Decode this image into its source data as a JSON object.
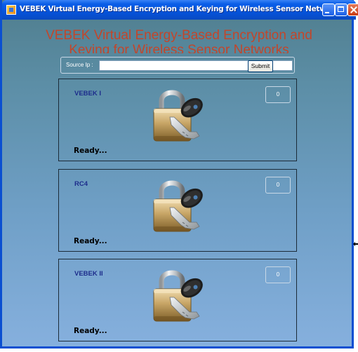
{
  "window": {
    "title": "VEBEK Virtual Energy-Based Encryption and Keying for Wireless Sensor Networks"
  },
  "heading": {
    "line1": "VEBEK Virtual Energy-Based Encryption and",
    "line2": "Keying for Wireless Sensor Networks"
  },
  "source": {
    "label": "Source Ip :",
    "value": "",
    "placeholder": "",
    "submit_label": "Submit"
  },
  "panels": [
    {
      "title": "VEBEK I",
      "count": "0",
      "status": "Ready..."
    },
    {
      "title": "RC4",
      "count": "0",
      "status": "Ready..."
    },
    {
      "title": "VEBEK II",
      "count": "0",
      "status": "Ready..."
    }
  ],
  "colors": {
    "titlebar": "#0551d6",
    "heading": "#c2462b",
    "panel_title": "#1d2d8c"
  },
  "icons": {
    "app": "app-icon",
    "lock": "padlock-key-icon"
  }
}
